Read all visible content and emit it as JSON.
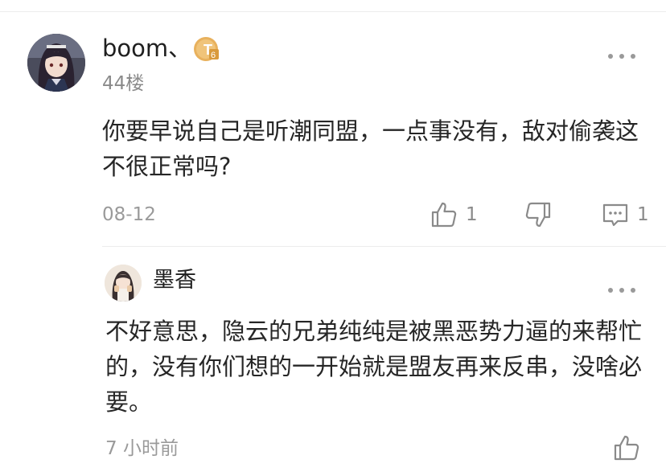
{
  "main_comment": {
    "username": "boom、",
    "badge_text": "T6",
    "floor": "44楼",
    "content": "你要早说自己是听潮同盟，一点事没有，敌对偷袭这不很正常吗?",
    "date": "08-12",
    "like_count": "1",
    "comment_count": "1"
  },
  "reply": {
    "username": "墨香",
    "content": "不好意思，隐云的兄弟纯纯是被黑恶势力逼的来帮忙的，没有你们想的一开始就是盟友再来反串，没啥必要。",
    "time": "7 小时前"
  },
  "colors": {
    "badge": "#e8b15d",
    "text_secondary": "#8a8a8a",
    "divider": "#ececec"
  },
  "icons": {
    "like": "thumbs-up-icon",
    "dislike": "thumbs-down-icon",
    "comment": "comment-bubble-icon",
    "more": "more-dots-icon"
  }
}
